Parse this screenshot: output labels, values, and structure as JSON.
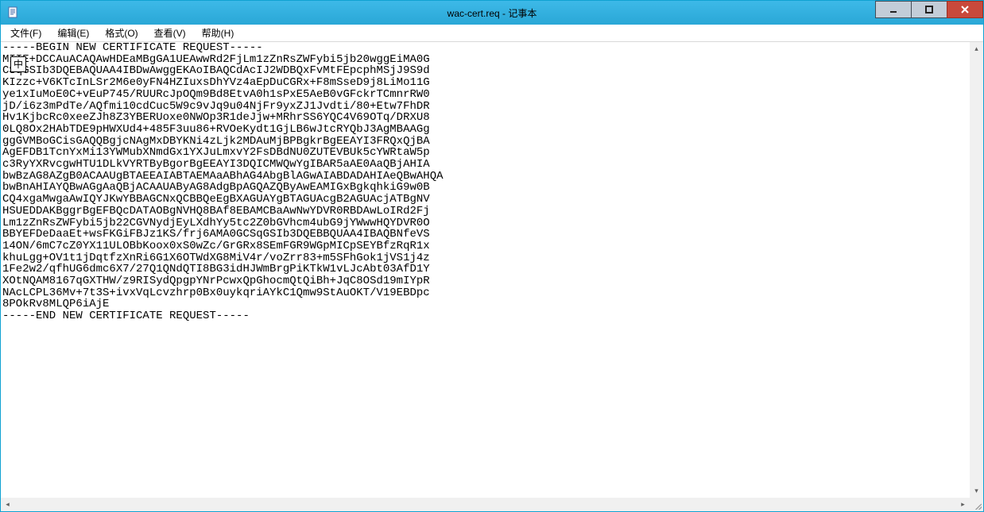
{
  "window": {
    "title": "wac-cert.req - 记事本"
  },
  "menubar": {
    "file": "文件(F)",
    "edit": "编辑(E)",
    "format": "格式(O)",
    "view": "查看(V)",
    "help": "帮助(H)"
  },
  "ime": {
    "label": "中"
  },
  "content": {
    "text": "-----BEGIN NEW CERTIFICATE REQUEST-----\nMIIE+DCCAuACAQAwHDEaMBgGA1UEAwwRd2FjLm1zZnRsZWFybi5jb20wggEiMA0G\nCSqGSIb3DQEBAQUAA4IBDwAwggEKAoIBAQCdAcIJ2WDBQxFvMtFEpcphMSjJ9S9d\nKIzzc+V6KTcInLSr2M6e0yFN4HZIuxsDhYVz4aEpDuCGRx+F8mSseD9j8LiMo11G\nye1xIuMoE0C+vEuP745/RUURcJpOQm9Bd8EtvA0h1sPxE5AeB0vGFckrTCmnrRW0\njD/i6z3mPdTe/AQfmi10cdCuc5W9c9vJq9u04NjFr9yxZJ1Jvdti/80+Etw7FhDR\nHv1KjbcRc0xeeZJh8Z3YBERUoxe0NWOp3R1deJjw+MRhrSS6YQC4V69OTq/DRXU8\n0LQ8Ox2HAbTDE9pHWXUd4+485F3uu86+RVOeKydt1GjLB6wJtcRYQbJ3AgMBAAGg\nggGVMBoGCisGAQQBgjcNAgMxDBYKNi4zLjk2MDAuMjBPBgkrBgEEAYI3FRQxQjBA\nAgEFDB1TcnYxMi13YWMubXNmdGx1YXJuLmxvY2FsDBdNU0ZUTEVBUk5cYWRtaW5p\nc3RyYXRvcgwHTU1DLkVYRTByBgorBgEEAYI3DQICMWQwYgIBAR5aAE0AaQBjAHIA\nbwBzAG8AZgB0ACAAUgBTAEEAIABTAEMAaABhAG4AbgBlAGwAIABDADAHIAeQBwAHQA\nbwBnAHIAYQBwAGgAaQBjACAAUAByAG8AdgBpAGQAZQByAwEAMIGxBgkqhkiG9w0B\nCQ4xgaMwgaAwIQYJKwYBBAGCNxQCBBQeEgBXAGUAYgBTAGUAcgB2AGUAcjATBgNV\nHSUEDDAKBggrBgEFBQcDATAOBgNVHQ8BAf8EBAMCBaAwNwYDVR0RBDAwLoIRd2Fj\nLm1zZnRsZWFybi5jb22CGVNydjEyLXdhYy5tc2Z0bGVhcm4ubG9jYWwwHQYDVR0O\nBBYEFDeDaaEt+wsFKGiFBJz1KS/frj6AMA0GCSqGSIb3DQEBBQUAA4IBAQBNfeVS\n14ON/6mC7cZ0YX11ULOBbKoox0xS0wZc/GrGRx8SEmFGR9WGpMICpSEYBfzRqR1x\nkhuLgg+OV1t1jDqtfzXnRi6G1X6OTWdXG8MiV4r/voZrr83+m5SFhGok1jVS1j4z\n1Fe2w2/qfhUG6dmc6X7/27Q1QNdQTI8BG3idHJWmBrgPiKTkW1vLJcAbt03AfD1Y\nXOtNQAM8167qGXTHW/z9RISydQpgpYNrPcwxQpGhocmQtQiBh+JqC8OSd19mIYpR\nNAcLCPL36Mv+7t3S+ivxVqLcvzhrp0Bx0uykqriAYkC1Qmw9StAuOKT/V19EBDpc\n8POkRv8MLQP6iAjE\n-----END NEW CERTIFICATE REQUEST-----"
  }
}
